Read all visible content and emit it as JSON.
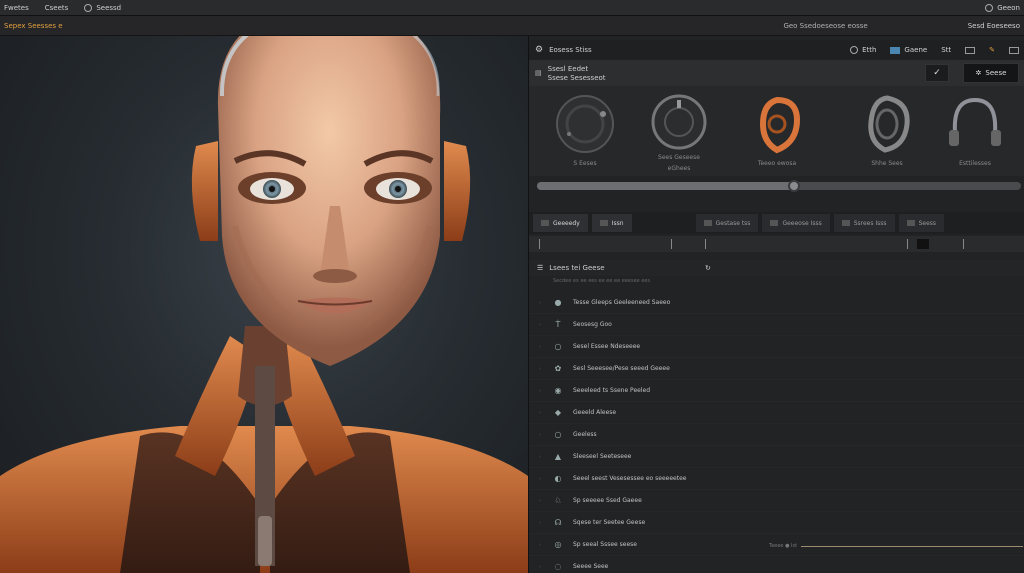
{
  "topbar": {
    "menu": [
      "Fwetes",
      "Cseets",
      "Seessd"
    ],
    "right_label": "Geeon"
  },
  "subbar": {
    "left_label": "Sepex Seesses e",
    "mid_label": "Geo Ssedoeseose eosse",
    "right_label": "Sesd Eoeseeso"
  },
  "panel": {
    "header": {
      "title": "Eosess Stiss",
      "tools": [
        "Etth",
        "Gaene",
        "Stt"
      ]
    },
    "sub": {
      "line1": "Ssesl Eedet",
      "line2": "Ssese Sesesseot",
      "button": "Seese"
    },
    "thumbs": [
      {
        "caption": "S Eeses"
      },
      {
        "caption": "Sees Geseese",
        "caption2": "eGhees"
      },
      {
        "caption": "Teeeo ewosa"
      },
      {
        "caption": "Shhe Sees"
      },
      {
        "caption": "Esttilesses"
      }
    ],
    "slider": {
      "value": 0.53
    },
    "tabs": [
      "Geeeedy",
      "Issn",
      "Gestase tss",
      "Geeeose Isss",
      "Ssrees Isss",
      "Seess"
    ],
    "list_title": "Lsees tei Geese",
    "list_subtitle": "Secdee ex ee ees ee ee ee eeesee ees",
    "items": [
      {
        "icon": "●",
        "label": "Tesse Gleeps Geeleeneed Saeeo"
      },
      {
        "icon": "Ṫ",
        "label": "Seosesg Goo"
      },
      {
        "icon": "○",
        "label": "Sesel Essee Ndeseeee"
      },
      {
        "icon": "✿",
        "label": "Sesl Seeesee/Pese seeed Geeee"
      },
      {
        "icon": "◉",
        "label": "Seeeleed ts Ssene Peeled"
      },
      {
        "icon": "◆",
        "label": "Geeeld Aleese"
      },
      {
        "icon": "○",
        "label": "Geeless"
      },
      {
        "icon": "▲",
        "label": "Sleeseel Seeteseee"
      },
      {
        "icon": "◐",
        "label": "Seeel seest Vesesessee eo seeeeetee"
      },
      {
        "icon": "♘",
        "label": "Sp seeeee Ssed Gaeee"
      },
      {
        "icon": "☊",
        "label": "Sqese ter Seetee Geese"
      },
      {
        "icon": "◎",
        "label": "Sp seeal Sssee seese"
      },
      {
        "icon": "◌",
        "label": "Seeee Seee"
      }
    ],
    "value_line_label": "Teeee ● Ist"
  },
  "colors": {
    "accent_orange": "#e0a040",
    "panel_bg": "#222325",
    "tool_blue": "#4a86b0"
  }
}
